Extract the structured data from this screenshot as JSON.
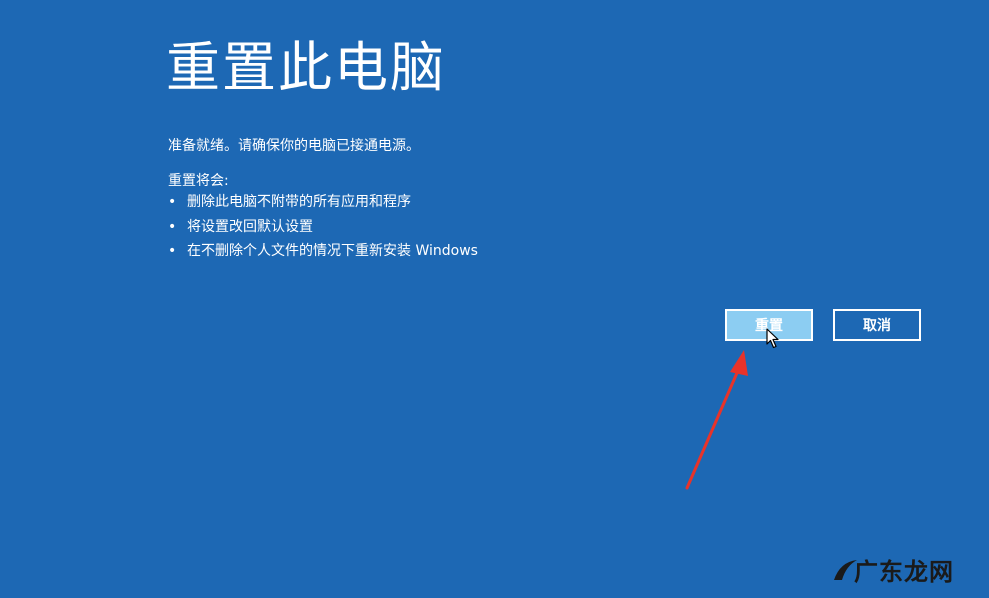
{
  "title": "重置此电脑",
  "ready_message": "准备就绪。请确保你的电脑已接通电源。",
  "reset_will_label": "重置将会:",
  "bullets": [
    "删除此电脑不附带的所有应用和程序",
    "将设置改回默认设置",
    "在不删除个人文件的情况下重新安装 Windows"
  ],
  "buttons": {
    "reset": "重置",
    "cancel": "取消"
  },
  "watermark": "广东龙网",
  "colors": {
    "background": "#1d68b4",
    "reset_button": "#8ccdf2",
    "annotation_arrow": "#e8332a"
  },
  "icons": {
    "cursor": "mouse-pointer-icon",
    "annotation": "red-arrow-icon",
    "bullet": "•"
  }
}
